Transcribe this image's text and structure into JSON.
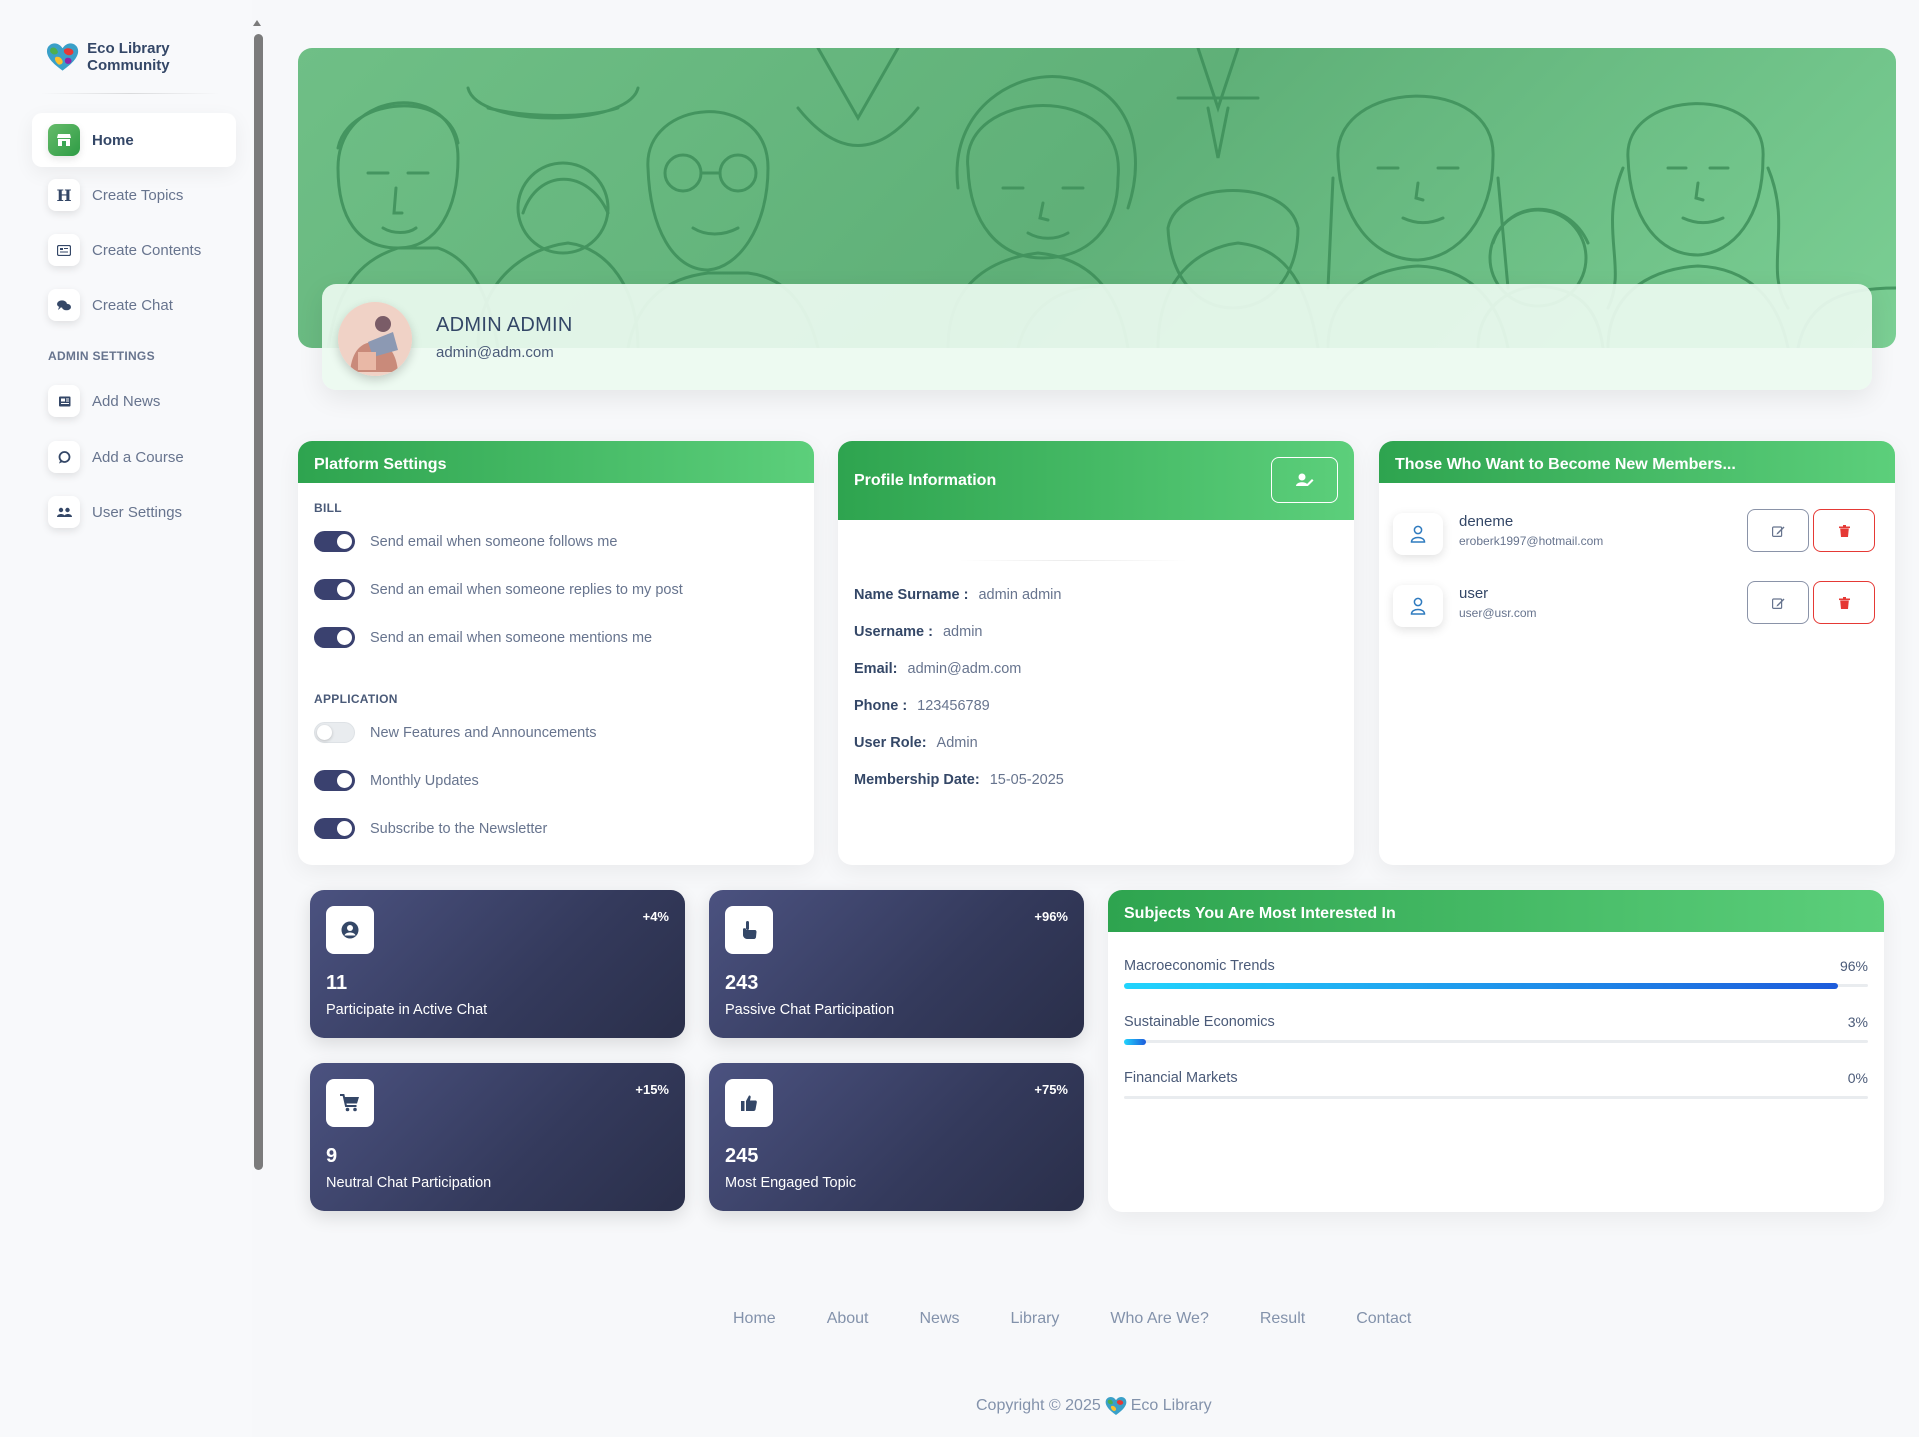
{
  "brand": {
    "name": "Eco Library Community"
  },
  "sidebar": {
    "items": [
      {
        "label": "Home",
        "icon": "store-icon"
      },
      {
        "label": "Create Topics",
        "icon": "heading-icon"
      },
      {
        "label": "Create Contents",
        "icon": "id-card-icon"
      },
      {
        "label": "Create Chat",
        "icon": "chat-icon"
      }
    ],
    "section_title": "ADMIN SETTINGS",
    "admin_items": [
      {
        "label": "Add News",
        "icon": "newspaper-icon"
      },
      {
        "label": "Add a Course",
        "icon": "speech-bubble-icon"
      },
      {
        "label": "User Settings",
        "icon": "users-icon"
      }
    ]
  },
  "profile": {
    "name": "ADMIN ADMIN",
    "email": "admin@adm.com"
  },
  "platform_settings": {
    "title": "Platform Settings",
    "section1": "BILL",
    "section2": "APPLICATION",
    "toggles": [
      {
        "label": "Send email when someone follows me",
        "on": true
      },
      {
        "label": "Send an email when someone replies to my post",
        "on": true
      },
      {
        "label": "Send an email when someone mentions me",
        "on": true
      },
      {
        "label": "New Features and Announcements",
        "on": false
      },
      {
        "label": "Monthly Updates",
        "on": true
      },
      {
        "label": "Subscribe to the Newsletter",
        "on": true
      }
    ]
  },
  "profile_info": {
    "title": "Profile Information",
    "rows": [
      {
        "key": "Name Surname :",
        "value": "admin admin"
      },
      {
        "key": "Username :",
        "value": "admin"
      },
      {
        "key": "Email:",
        "value": "admin@adm.com"
      },
      {
        "key": "Phone :",
        "value": "123456789"
      },
      {
        "key": "User Role:",
        "value": "Admin"
      },
      {
        "key": "Membership Date:",
        "value": "15-05-2025"
      }
    ]
  },
  "members": {
    "title": "Those Who Want to Become New Members...",
    "list": [
      {
        "name": "deneme",
        "email": "eroberk1997@hotmail.com"
      },
      {
        "name": "user",
        "email": "user@usr.com"
      }
    ]
  },
  "stats": [
    {
      "value": "11",
      "label": "Participate in Active Chat",
      "pct": "+4%",
      "icon": "user-circle-icon"
    },
    {
      "value": "243",
      "label": "Passive Chat Participation",
      "pct": "+96%",
      "icon": "pointer-hand-icon"
    },
    {
      "value": "9",
      "label": "Neutral Chat Participation",
      "pct": "+15%",
      "icon": "cart-icon"
    },
    {
      "value": "245",
      "label": "Most Engaged Topic",
      "pct": "+75%",
      "icon": "thumbs-up-icon"
    }
  ],
  "subjects": {
    "title": "Subjects You Are Most Interested In",
    "items": [
      {
        "name": "Macroeconomic Trends",
        "pct_label": "96%",
        "pct": 96
      },
      {
        "name": "Sustainable Economics",
        "pct_label": "3%",
        "pct": 3
      },
      {
        "name": "Financial Markets",
        "pct_label": "0%",
        "pct": 0
      }
    ]
  },
  "footer": {
    "links": [
      "Home",
      "About",
      "News",
      "Library",
      "Who Are We?",
      "Result",
      "Contact"
    ],
    "copyright_prefix": "Copyright © 2025",
    "copyright_suffix": "Eco Library"
  },
  "colors": {
    "accent_green": "#2ea44f",
    "dark_card": "#3a416f",
    "danger": "#e53935",
    "progress": "#1d5bdb"
  }
}
